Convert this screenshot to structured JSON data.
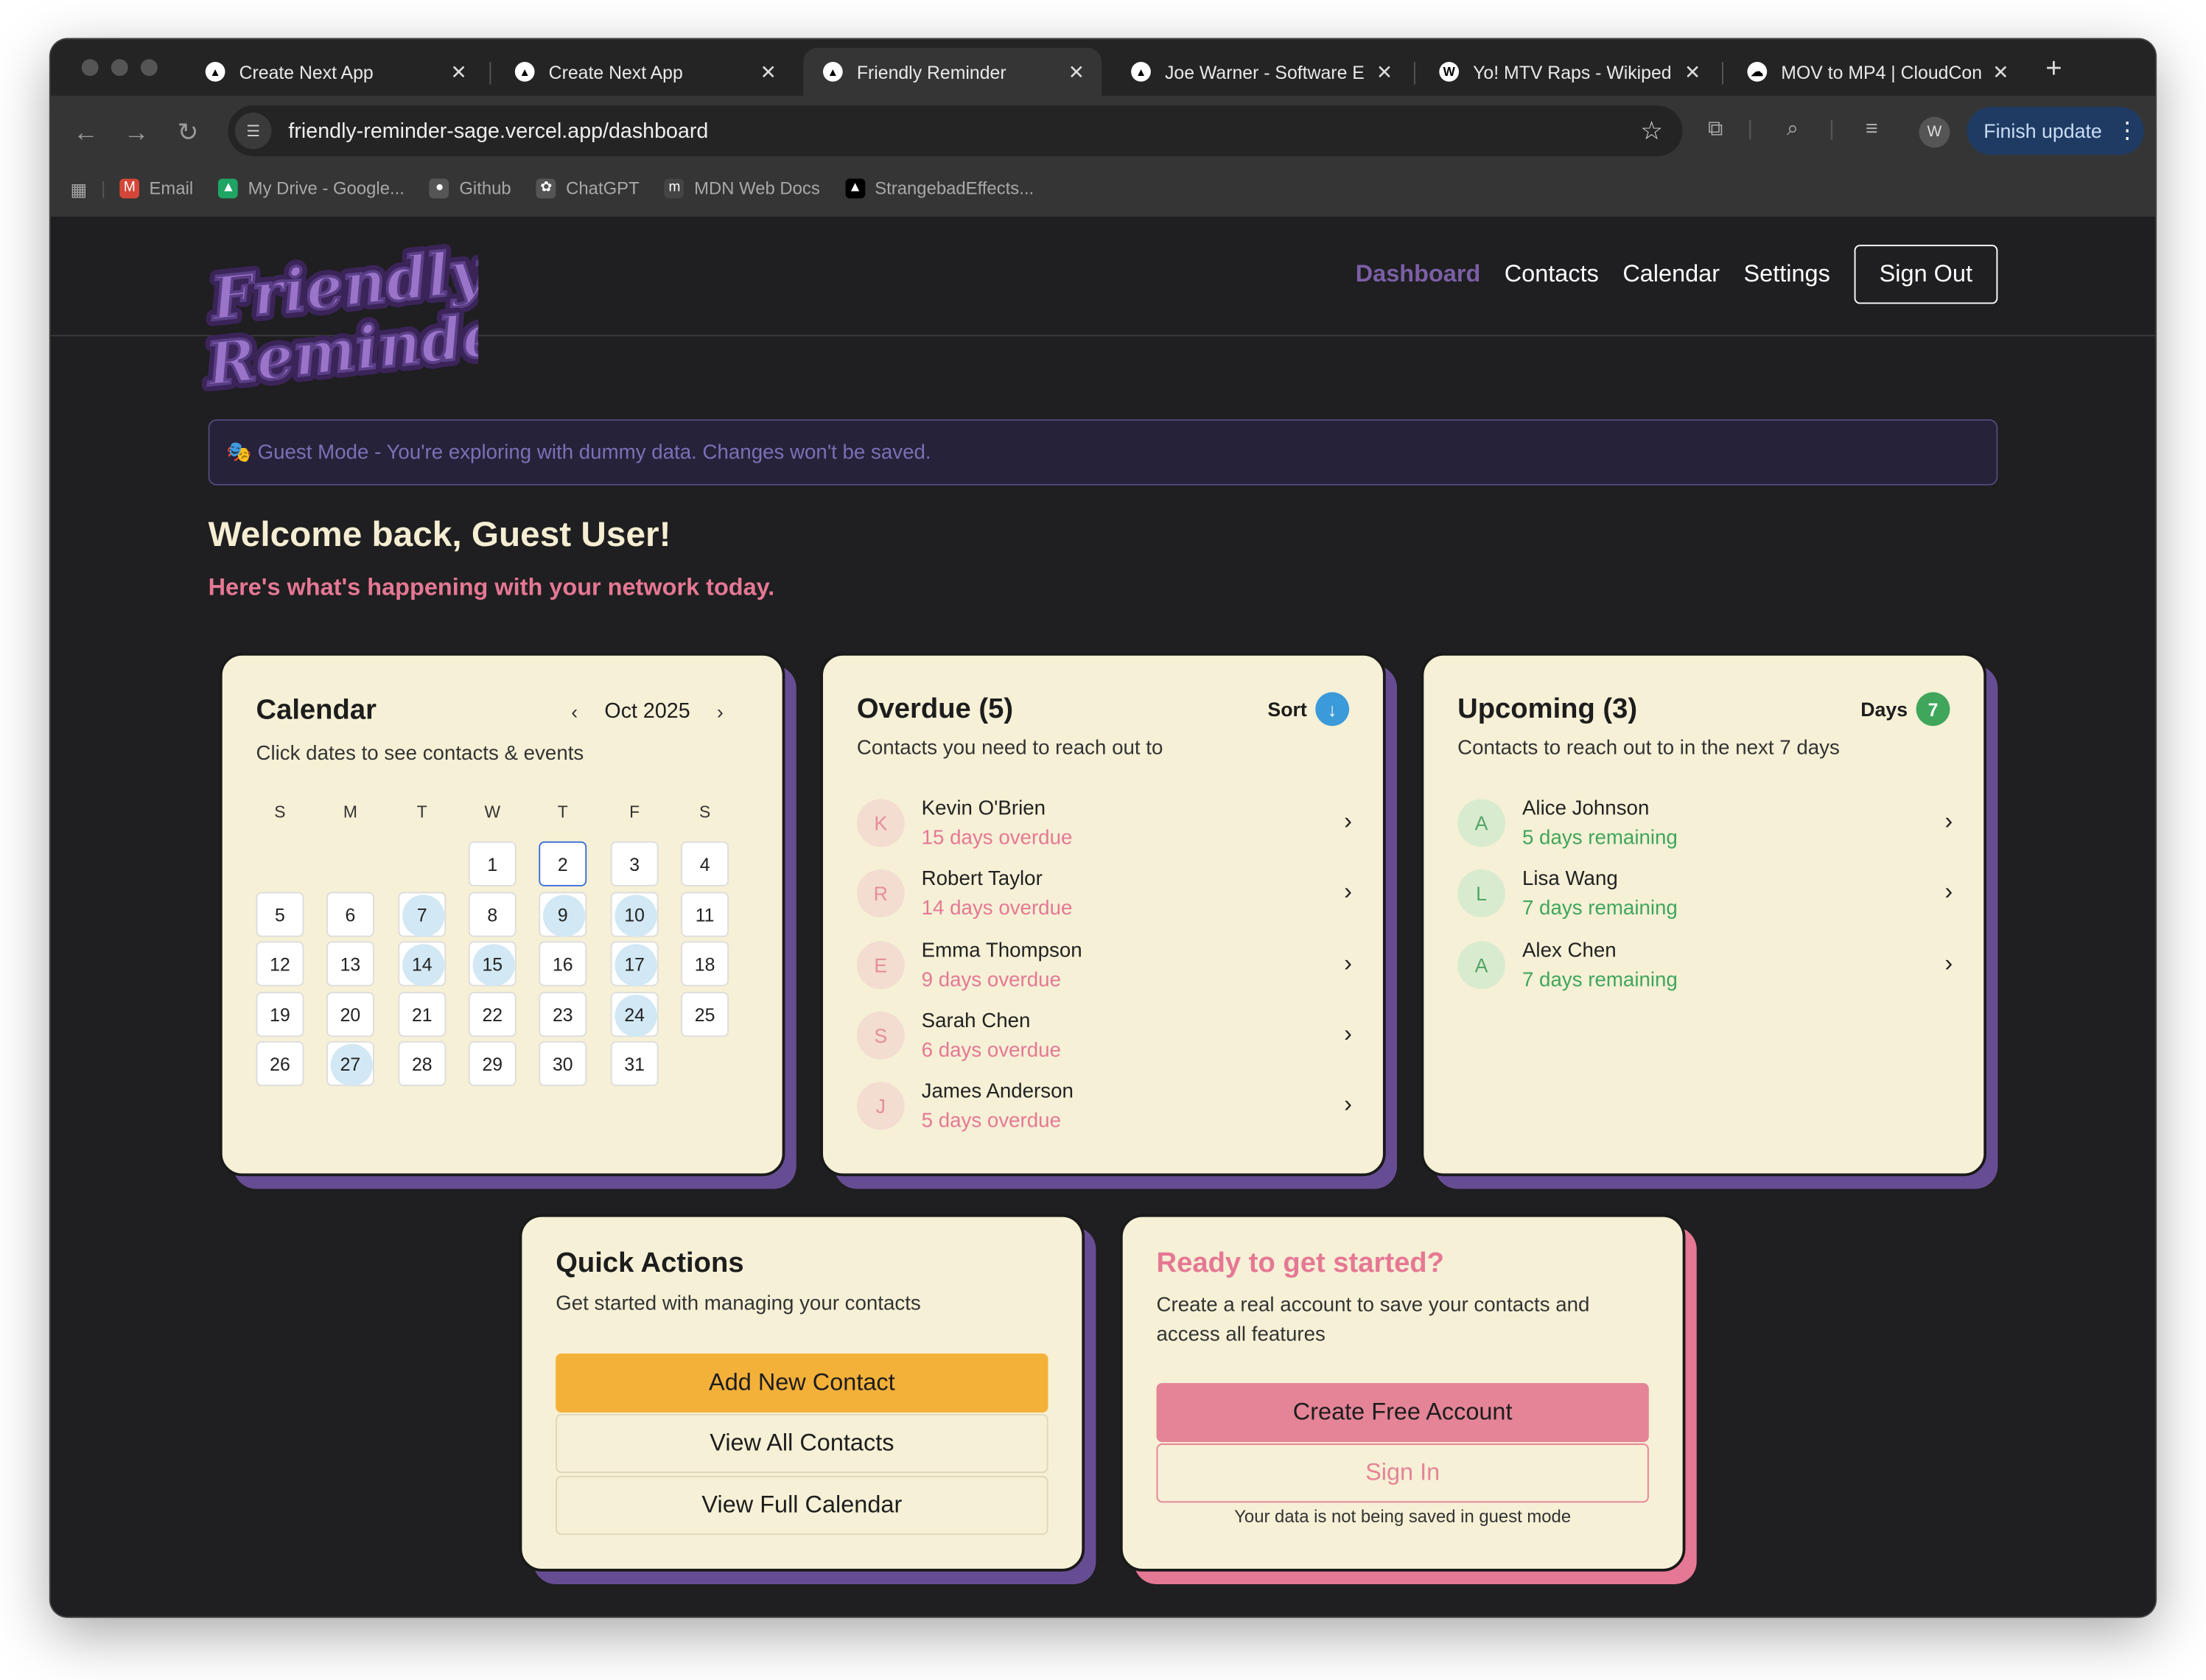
{
  "browser": {
    "tabs": [
      {
        "title": "Create Next App",
        "icon": "nextjs-icon"
      },
      {
        "title": "Create Next App",
        "icon": "nextjs-icon"
      },
      {
        "title": "Friendly Reminder",
        "icon": "nextjs-icon"
      },
      {
        "title": "Joe Warner - Software E",
        "icon": "nextjs-icon"
      },
      {
        "title": "Yo! MTV Raps - Wikiped",
        "icon": "wikipedia-icon"
      },
      {
        "title": "MOV to MP4 | CloudCon",
        "icon": "cloudconvert-icon"
      }
    ],
    "active_tab": 2,
    "url": "friendly-reminder-sage.vercel.app/dashboard",
    "profile_initial": "W",
    "update_label": "Finish update",
    "bookmarks": [
      {
        "label": "Email",
        "icon": "gmail-icon"
      },
      {
        "label": "My Drive - Google...",
        "icon": "google-drive-icon"
      },
      {
        "label": "Github",
        "icon": "github-icon"
      },
      {
        "label": "ChatGPT",
        "icon": "chatgpt-icon"
      },
      {
        "label": "MDN Web Docs",
        "icon": "mdn-icon"
      },
      {
        "label": "StrangebadEffects...",
        "icon": "nextjs-icon"
      }
    ]
  },
  "app": {
    "logo_line1": "Friendly",
    "logo_line2": "Reminder",
    "nav": [
      "Dashboard",
      "Contacts",
      "Calendar",
      "Settings"
    ],
    "active_nav": "Dashboard",
    "sign_out": "Sign Out",
    "guest_banner": "🎭 Guest Mode - You're exploring with dummy data. Changes won't be saved.",
    "welcome": "Welcome back, Guest User!",
    "subtitle": "Here's what's happening with your network today.",
    "colors": {
      "accent_purple": "#7b5fa6",
      "accent_pink": "#e57894",
      "card_bg": "#f6f0d6",
      "primary_button": "#f4b13a"
    }
  },
  "calendar": {
    "title": "Calendar",
    "description": "Click dates to see contacts & events",
    "month_label": "Oct 2025",
    "weekdays": [
      "S",
      "M",
      "T",
      "W",
      "T",
      "F",
      "S"
    ],
    "first_weekday_index": 3,
    "days_in_month": 31,
    "today": 2,
    "highlighted_days": [
      7,
      9,
      10,
      14,
      15,
      17,
      24,
      27
    ],
    "days": [
      "1",
      "2",
      "3",
      "4",
      "5",
      "6",
      "7",
      "8",
      "9",
      "10",
      "11",
      "12",
      "13",
      "14",
      "15",
      "16",
      "17",
      "18",
      "19",
      "20",
      "21",
      "22",
      "23",
      "24",
      "25",
      "26",
      "27",
      "28",
      "29",
      "30",
      "31"
    ]
  },
  "overdue": {
    "title": "Overdue (5)",
    "description": "Contacts you need to reach out to",
    "sort_label": "Sort",
    "contacts": [
      {
        "initial": "K",
        "name": "Kevin O'Brien",
        "status": "15 days overdue"
      },
      {
        "initial": "R",
        "name": "Robert Taylor",
        "status": "14 days overdue"
      },
      {
        "initial": "E",
        "name": "Emma Thompson",
        "status": "9 days overdue"
      },
      {
        "initial": "S",
        "name": "Sarah Chen",
        "status": "6 days overdue"
      },
      {
        "initial": "J",
        "name": "James Anderson",
        "status": "5 days overdue"
      }
    ]
  },
  "upcoming": {
    "title": "Upcoming (3)",
    "description": "Contacts to reach out to in the next 7 days",
    "days_label": "Days",
    "days_value": "7",
    "contacts": [
      {
        "initial": "A",
        "name": "Alice Johnson",
        "status": "5 days remaining"
      },
      {
        "initial": "L",
        "name": "Lisa Wang",
        "status": "7 days remaining"
      },
      {
        "initial": "A",
        "name": "Alex Chen",
        "status": "7 days remaining"
      }
    ]
  },
  "quick_actions": {
    "title": "Quick Actions",
    "description": "Get started with managing your contacts",
    "add_contact": "Add New Contact",
    "view_contacts": "View All Contacts",
    "view_calendar": "View Full Calendar"
  },
  "get_started": {
    "title": "Ready to get started?",
    "description": "Create a real account to save your contacts and access all features",
    "create_account": "Create Free Account",
    "sign_in": "Sign In",
    "note": "Your data is not being saved in guest mode"
  }
}
